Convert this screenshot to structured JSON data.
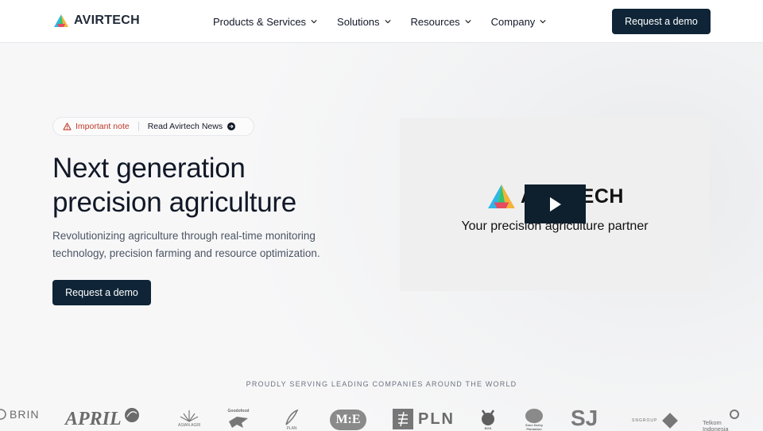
{
  "header": {
    "brand": "AVIRTECH",
    "nav": [
      {
        "label": "Products & Services"
      },
      {
        "label": "Solutions"
      },
      {
        "label": "Resources"
      },
      {
        "label": "Company"
      }
    ],
    "cta_label": "Request a demo"
  },
  "notice": {
    "important_label": "Important note",
    "link_label": "Read Avirtech News"
  },
  "hero": {
    "title_line1": "Next generation",
    "title_line2": "precision agriculture",
    "subtitle": "Revolutionizing agriculture through real-time monitoring technology, precision farming and resource optimization.",
    "cta_label": "Request a demo"
  },
  "video": {
    "brand": "AVIRTECH",
    "tagline": "Your precision agriculture partner"
  },
  "clients": {
    "heading": "PROUDLY SERVING LEADING COMPANIES AROUND THE WORLD",
    "logos": {
      "brin": "BRIN",
      "april": "APRIL",
      "asian_agri": "ASIAN AGRI",
      "goodfood": "Goodofood",
      "plan": "PLAN",
      "me": "M:E",
      "pln": "PLN",
      "bgs": "BGS",
      "sime_darby": "Sime Darby Plantation",
      "sj": "SJ",
      "sngroup": "SNGROUP",
      "telkom": "Telkom Indonesia"
    }
  },
  "colors": {
    "primary_dark": "#0f2537",
    "alert_red": "#c0392b"
  }
}
